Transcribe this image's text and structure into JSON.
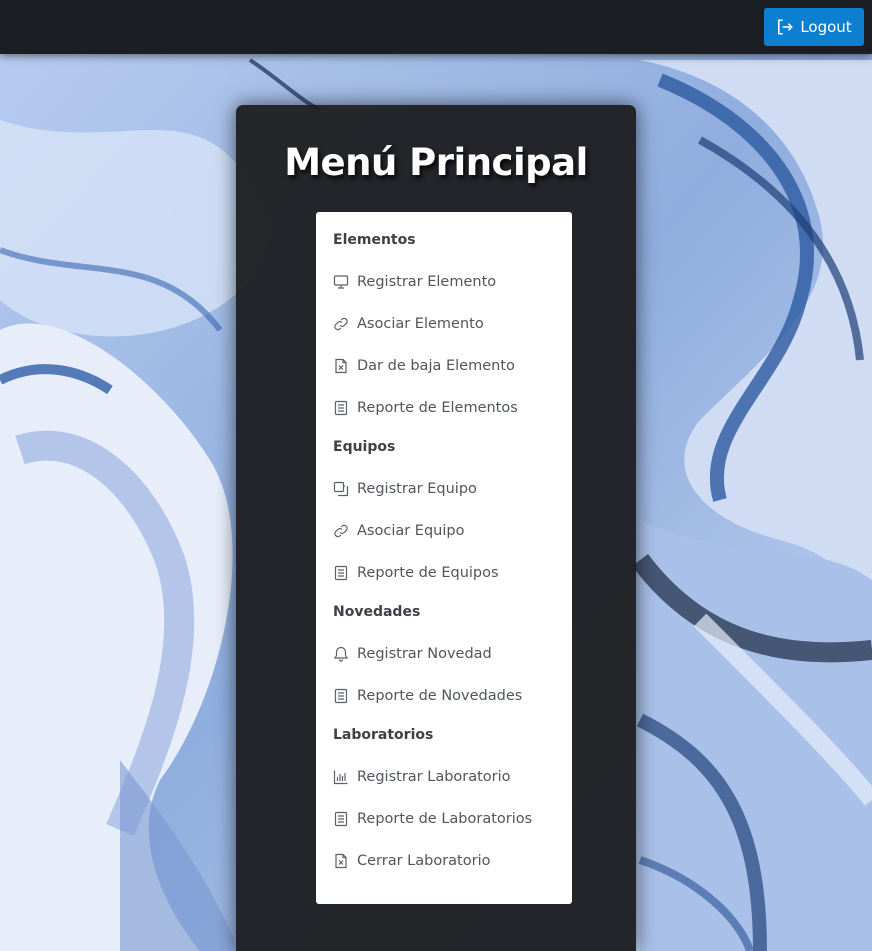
{
  "header": {
    "logout_label": "Logout",
    "logout_icon": "logout-icon"
  },
  "panel": {
    "title": "Menú Principal"
  },
  "menu": {
    "elementos": {
      "title": "Elementos",
      "items": [
        {
          "label": "Registrar Elemento",
          "icon": "monitor-icon"
        },
        {
          "label": "Asociar Elemento",
          "icon": "link-icon"
        },
        {
          "label": "Dar de baja Elemento",
          "icon": "file-x-icon"
        },
        {
          "label": "Reporte de Elementos",
          "icon": "document-icon"
        }
      ]
    },
    "equipos": {
      "title": "Equipos",
      "items": [
        {
          "label": "Registrar Equipo",
          "icon": "copy-icon"
        },
        {
          "label": "Asociar Equipo",
          "icon": "link-icon"
        },
        {
          "label": "Reporte de Equipos",
          "icon": "document-icon"
        }
      ]
    },
    "novedades": {
      "title": "Novedades",
      "items": [
        {
          "label": "Registrar Novedad",
          "icon": "bell-icon"
        },
        {
          "label": "Reporte de Novedades",
          "icon": "document-icon"
        }
      ]
    },
    "laboratorios": {
      "title": "Laboratorios",
      "items": [
        {
          "label": "Registrar Laboratorio",
          "icon": "bar-chart-icon"
        },
        {
          "label": "Reporte de Laboratorios",
          "icon": "document-icon"
        },
        {
          "label": "Cerrar Laboratorio",
          "icon": "file-x-icon"
        }
      ]
    }
  },
  "colors": {
    "topbar": "#1b1e22",
    "logout_button": "#0d7fd0",
    "panel": "#1e1f22",
    "card": "#ffffff"
  }
}
